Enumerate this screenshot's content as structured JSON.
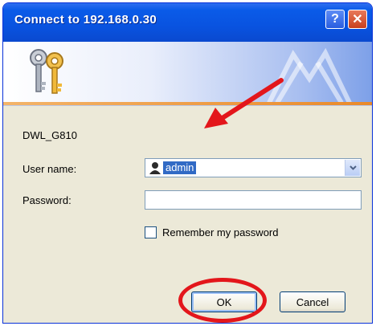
{
  "window": {
    "title": "Connect to 192.168.0.30",
    "help_glyph": "?",
    "close_glyph": "✕"
  },
  "banner": {
    "icon": "keys-icon"
  },
  "dialog": {
    "site_name": "DWL_G810",
    "username_label": "User name:",
    "username_value": "admin",
    "password_label": "Password:",
    "password_value": "",
    "remember_label": "Remember my password",
    "remember_checked": false,
    "ok_label": "OK",
    "cancel_label": "Cancel"
  },
  "annotations": {
    "color": "#e3161b"
  },
  "colors": {
    "titlebar": "#0953e0",
    "dialog_bg": "#ece9d8",
    "selection": "#316ac5"
  }
}
